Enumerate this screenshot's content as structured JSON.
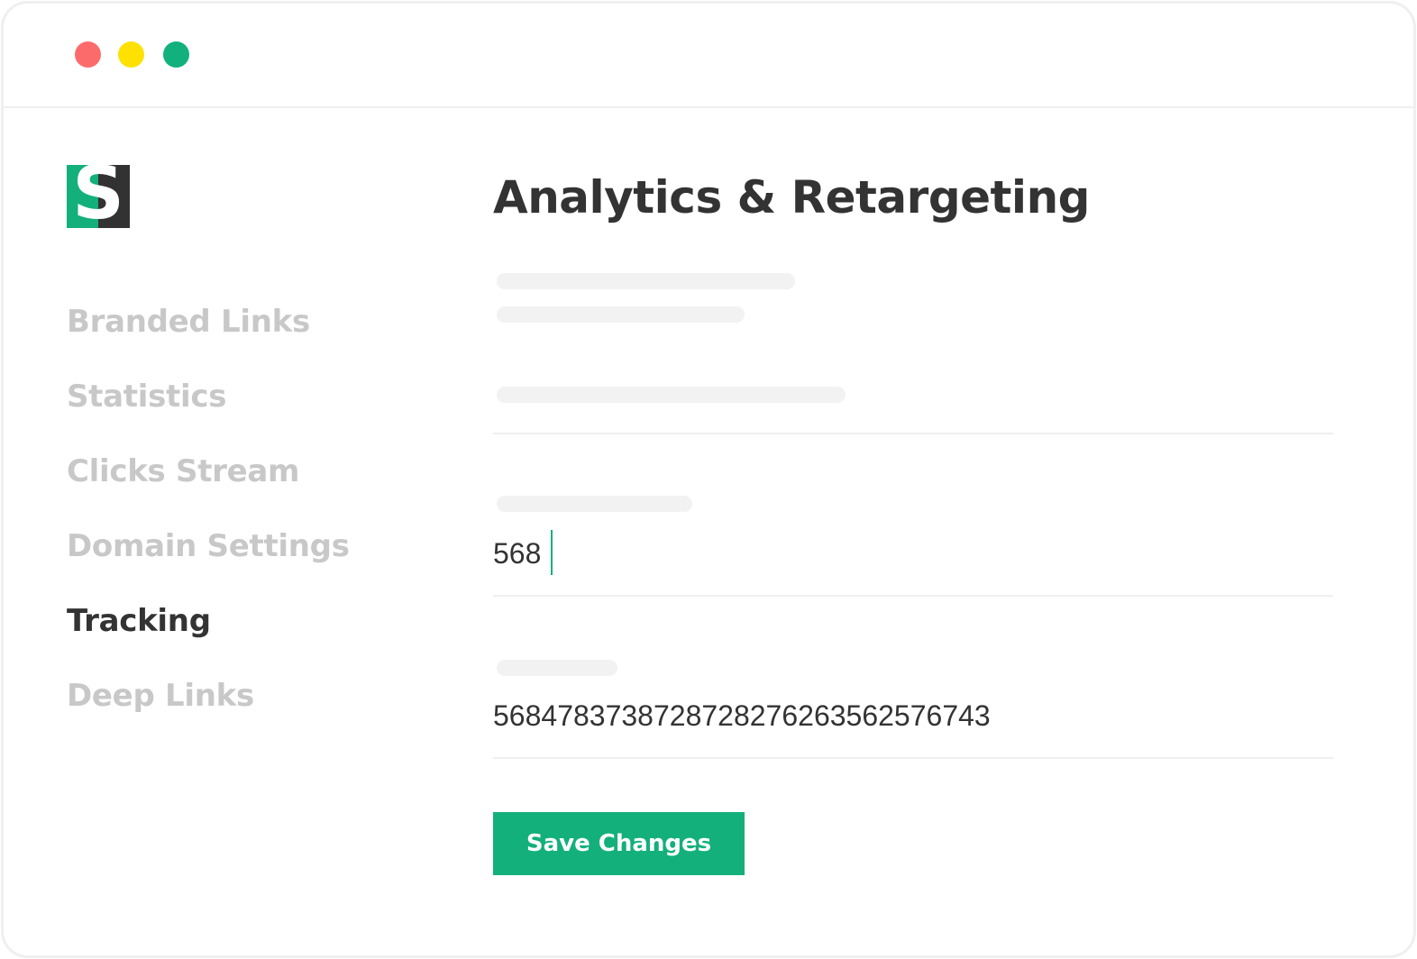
{
  "window": {
    "controls": [
      {
        "name": "close",
        "color": "#fc6b6b"
      },
      {
        "name": "minimize",
        "color": "#ffe100"
      },
      {
        "name": "maximize",
        "color": "#11b07d"
      }
    ]
  },
  "logo": {
    "letter": "S",
    "colors": {
      "left": "#13b07c",
      "right": "#323232",
      "letter": "#ffffff"
    }
  },
  "sidebar": {
    "items": [
      {
        "label": "Branded Links",
        "active": false
      },
      {
        "label": "Statistics",
        "active": false
      },
      {
        "label": "Clicks Stream",
        "active": false
      },
      {
        "label": "Domain Settings",
        "active": false
      },
      {
        "label": "Tracking",
        "active": true
      },
      {
        "label": "Deep Links",
        "active": false
      }
    ]
  },
  "main": {
    "title": "Analytics & Retargeting",
    "fields": [
      {
        "value": "568",
        "focused": true
      },
      {
        "value": "5684783738728728276263562576743",
        "focused": false
      }
    ],
    "save_label": "Save Changes"
  },
  "colors": {
    "accent": "#13b07c",
    "text_primary": "#333333",
    "text_muted": "#c8c8c8",
    "skeleton": "#f2f2f2",
    "divider": "#efefef"
  }
}
